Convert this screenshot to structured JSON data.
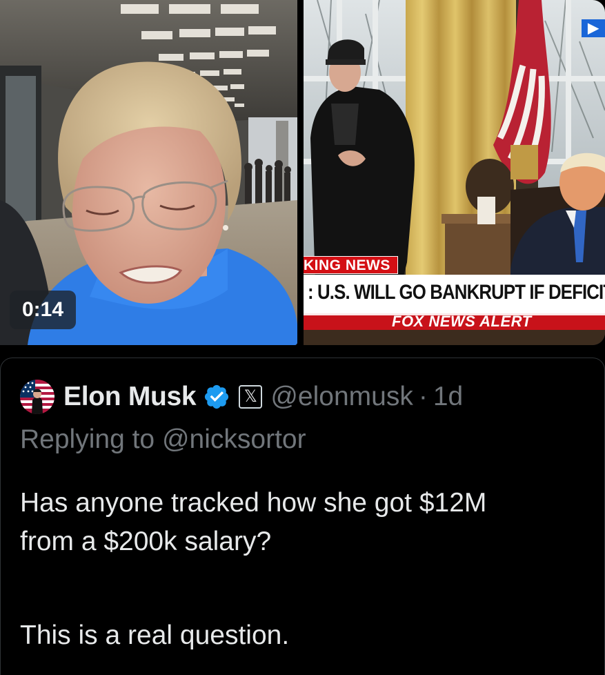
{
  "media": {
    "duration": "0:14",
    "news": {
      "top_bar": "KING NEWS",
      "headline": ": U.S. WILL GO BANKRUPT IF DEFICIT",
      "alert": "FOX NEWS ALERT",
      "play_mark": "▶"
    },
    "colors": {
      "fox_red": "#d40f14",
      "jacket_blue": "#2e7ce6"
    }
  },
  "quoted_tweet": {
    "display_name": "Elon Musk",
    "affiliation_icon": "x-logo-icon",
    "handle": "@elonmusk",
    "separator": "·",
    "time": "1d",
    "reply_prefix": "Replying to",
    "reply_to": "@nicksortor",
    "text_line1": "Has anyone tracked how she got $12M",
    "text_line2": "from a $200k salary?",
    "text_line3": "This is a real question.",
    "colors": {
      "verified": "#1d9bf0",
      "muted": "#71767b",
      "text": "#e7e9ea",
      "border": "#2f3336"
    }
  }
}
